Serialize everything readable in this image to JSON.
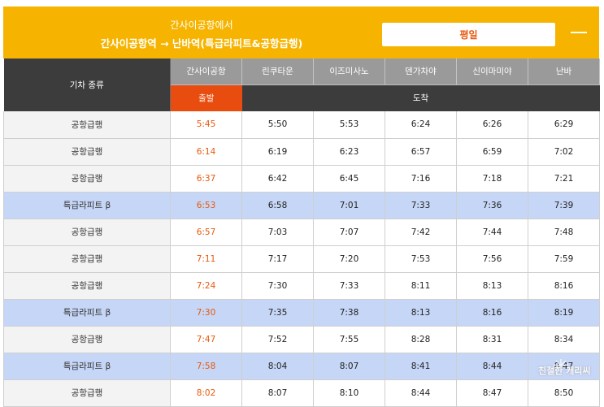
{
  "header": {
    "subtitle": "간사이공항에서",
    "title": "간사이공항역 → 난바역(특급라피트&공항급행)",
    "day_select": "평일"
  },
  "table": {
    "type_header": "기차 종류",
    "stations": [
      "간사이공항",
      "린쿠타운",
      "이즈미사노",
      "덴가차야",
      "신이마미야",
      "난바"
    ],
    "depart_label": "출발",
    "arrive_label": "도착",
    "rows": [
      {
        "type": "공항급행",
        "rapit": false,
        "times": [
          "5:45",
          "5:50",
          "5:53",
          "6:24",
          "6:26",
          "6:29"
        ]
      },
      {
        "type": "공항급행",
        "rapit": false,
        "times": [
          "6:14",
          "6:19",
          "6:23",
          "6:57",
          "6:59",
          "7:02"
        ]
      },
      {
        "type": "공항급행",
        "rapit": false,
        "times": [
          "6:37",
          "6:42",
          "6:45",
          "7:16",
          "7:18",
          "7:21"
        ]
      },
      {
        "type": "특급라피트 β",
        "rapit": true,
        "times": [
          "6:53",
          "6:58",
          "7:01",
          "7:33",
          "7:36",
          "7:39"
        ]
      },
      {
        "type": "공항급행",
        "rapit": false,
        "times": [
          "6:57",
          "7:03",
          "7:07",
          "7:42",
          "7:44",
          "7:48"
        ]
      },
      {
        "type": "공항급행",
        "rapit": false,
        "times": [
          "7:11",
          "7:17",
          "7:20",
          "7:53",
          "7:56",
          "7:59"
        ]
      },
      {
        "type": "공항급행",
        "rapit": false,
        "times": [
          "7:24",
          "7:30",
          "7:33",
          "8:11",
          "8:13",
          "8:16"
        ]
      },
      {
        "type": "특급라피트 β",
        "rapit": true,
        "times": [
          "7:30",
          "7:35",
          "7:38",
          "8:13",
          "8:16",
          "8:19"
        ]
      },
      {
        "type": "공항급행",
        "rapit": false,
        "times": [
          "7:47",
          "7:52",
          "7:55",
          "8:28",
          "8:31",
          "8:34"
        ]
      },
      {
        "type": "특급라피트 β",
        "rapit": true,
        "times": [
          "7:58",
          "8:04",
          "8:07",
          "8:41",
          "8:44",
          "8:47"
        ]
      },
      {
        "type": "공항급행",
        "rapit": false,
        "times": [
          "8:02",
          "8:07",
          "8:10",
          "8:44",
          "8:47",
          "8:50"
        ]
      }
    ]
  },
  "watermark": "친절한 캐리씨",
  "colors": {
    "header_bg": "#f6b400",
    "depart_bg": "#e84c0e",
    "depart_text": "#e8590c",
    "rapit_row": "#c6d6f6",
    "dark_header": "#3c3c3c",
    "station_header": "#9a9a9a"
  },
  "icons": {
    "collapse": "minus-icon"
  }
}
